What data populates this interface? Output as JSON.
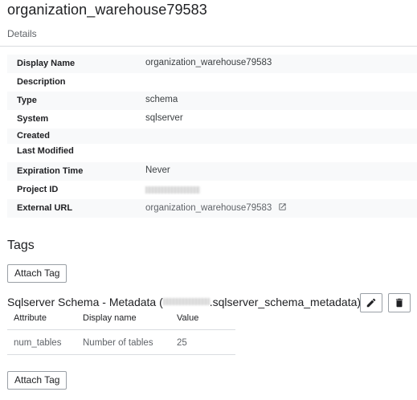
{
  "page": {
    "title": "organization_warehouse79583"
  },
  "tabs": [
    {
      "label": "Details"
    }
  ],
  "details": {
    "rows": [
      {
        "label": "Display Name",
        "value": "organization_warehouse79583"
      },
      {
        "label": "Description",
        "value": ""
      },
      {
        "label": "Type",
        "value": "schema"
      },
      {
        "label": "System",
        "value": "sqlserver"
      },
      {
        "label": "Created",
        "value": ""
      },
      {
        "label": "Last Modified",
        "value": ""
      },
      {
        "label": "Expiration Time",
        "value": "Never"
      },
      {
        "label": "Project ID",
        "value": ""
      },
      {
        "label": "External URL",
        "value": "organization_warehouse79583"
      }
    ]
  },
  "tags": {
    "heading": "Tags",
    "attach_label": "Attach Tag",
    "template": {
      "title_prefix": "Sqlserver Schema - Metadata (",
      "title_suffix": ".sqlserver_schema_metadata)",
      "columns": [
        "Attribute",
        "Display name",
        "Value"
      ],
      "rows": [
        {
          "attribute": "num_tables",
          "display_name": "Number of tables",
          "value": "25"
        }
      ]
    }
  },
  "colors": {
    "text_primary": "#202124",
    "text_secondary": "#5f6368",
    "row_shade": "#f8f9fa",
    "divider": "#dadce0"
  },
  "icons": {
    "external_link": "external-link-icon",
    "edit": "pencil-icon",
    "delete": "trash-icon"
  }
}
